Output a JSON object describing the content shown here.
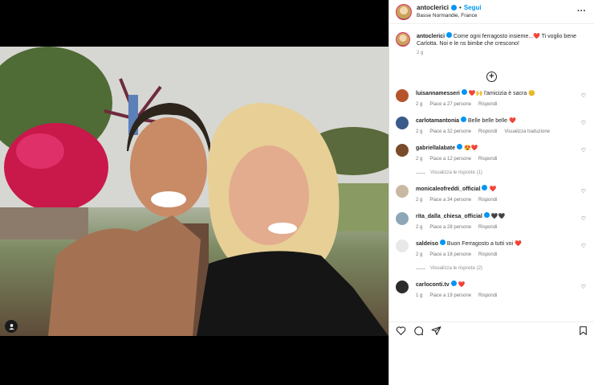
{
  "post": {
    "username": "antoclerici",
    "follow_label": "Segui",
    "location": "Basse Normandie, France"
  },
  "caption": {
    "username": "antoclerici",
    "text": "Come ogni ferragosto insieme...❤️ Ti voglio bene Carlotta. Noi e le ns bimbe che crescono!",
    "time": "2 g"
  },
  "comments": [
    {
      "user": "luisannamesseri",
      "text": "❤️🙌 l'amicizia è sacra 😊",
      "time": "2 g",
      "likes": "Piace a 27 persone",
      "reply": "Rispondi",
      "translate": "",
      "avatar_color": "#b5542b"
    },
    {
      "user": "carlotamantonia",
      "text": "Belle belle belle ❤️",
      "time": "2 g",
      "likes": "Piace a 32 persone",
      "reply": "Rispondi",
      "translate": "Visualizza traduzione",
      "avatar_color": "#3a5a8c"
    },
    {
      "user": "gabriellalabate",
      "text": "😍❤️",
      "time": "2 g",
      "likes": "Piace a 12 persone",
      "reply": "Rispondi",
      "translate": "",
      "avatar_color": "#7a4b2a",
      "replies": "Visualizza le risposte (1)"
    },
    {
      "user": "monicaleofreddi_official",
      "text": "❤️",
      "time": "2 g",
      "likes": "Piace a 34 persone",
      "reply": "Rispondi",
      "translate": "",
      "avatar_color": "#c9b9a3"
    },
    {
      "user": "rita_dalla_chiesa_official",
      "text": "🖤🖤",
      "time": "2 g",
      "likes": "Piace a 28 persone",
      "reply": "Rispondi",
      "translate": "",
      "avatar_color": "#8ea7b8"
    },
    {
      "user": "saldeiso",
      "text": "Buon Ferragosto a tutti voi ❤️",
      "time": "2 g",
      "likes": "Piace a 18 persone",
      "reply": "Rispondi",
      "translate": "",
      "avatar_color": "#e8e8e8",
      "replies": "Visualizza le risposte (2)"
    },
    {
      "user": "carloconti.tv",
      "text": "❤️",
      "time": "1 g",
      "likes": "Piace a 19 persone",
      "reply": "Rispondi",
      "translate": "",
      "avatar_color": "#2b2b2b"
    }
  ],
  "icons": {
    "more": "more-horizontal-icon",
    "add": "plus-circle-icon",
    "like": "heart-icon",
    "comment": "comment-icon",
    "share": "send-icon",
    "save": "bookmark-icon",
    "user_tag": "user-tag-icon"
  },
  "colors": {
    "verified": "#0095f6",
    "follow": "#0095f6",
    "heart": "#ed4956"
  }
}
